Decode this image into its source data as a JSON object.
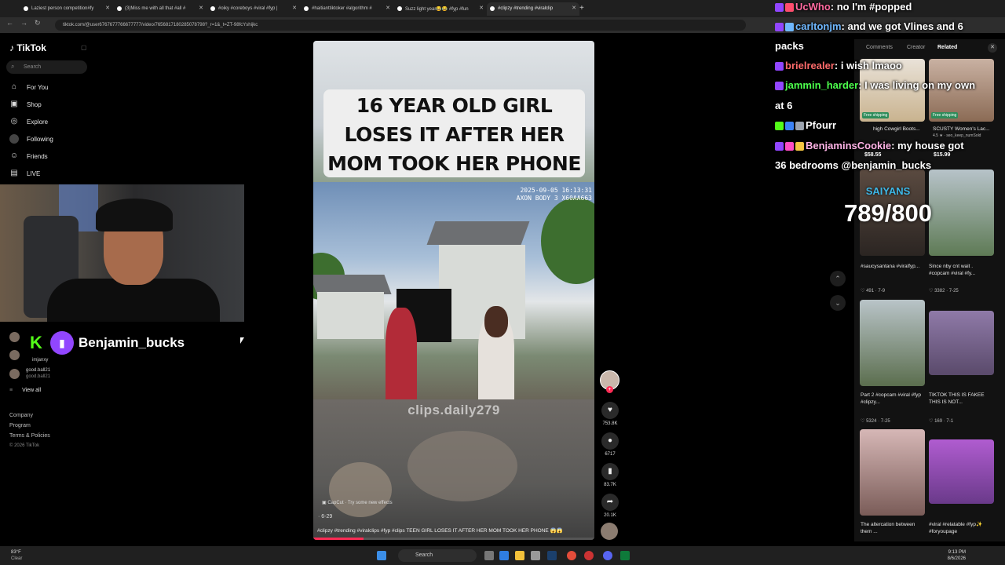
{
  "browser": {
    "tabs": [
      {
        "title": "Laziest person competition#fy"
      },
      {
        "title": "(3)Miss me with all that #all #"
      },
      {
        "title": "#oiky #coreboys #viral #fyp |"
      },
      {
        "title": "#haitianttiktoker #algorithm #"
      },
      {
        "title": "Suzz light year😂😂 #fyp #fun"
      },
      {
        "title": "#clipzy #trending #viralclip"
      }
    ],
    "url": "tiktok.com/@user6767677766677777/video/7656817180285078798?_r=1&_t=ZT-98fcYshijkc"
  },
  "sidebar": {
    "logo": "TikTok",
    "search_placeholder": "Search",
    "nav": [
      {
        "label": "For You",
        "icon": "home-icon"
      },
      {
        "label": "Shop",
        "icon": "shop-icon"
      },
      {
        "label": "Explore",
        "icon": "compass-icon"
      },
      {
        "label": "Following",
        "icon": "following-icon"
      },
      {
        "label": "Friends",
        "icon": "friends-icon"
      },
      {
        "label": "LIVE",
        "icon": "live-icon"
      }
    ],
    "following": [
      {
        "name": "imjanxy",
        "handle": "imjanxy"
      },
      {
        "name": "good.ball21",
        "handle": "good.ball21"
      }
    ],
    "view_all": "View all",
    "footer": [
      "Company",
      "Program",
      "Terms & Policies",
      "© 2026 TikTok"
    ]
  },
  "stream": {
    "twitch_name": "Benjamin_bucks"
  },
  "video": {
    "headline": "16 YEAR OLD GIRL LOSES IT AFTER HER MOM TOOK HER PHONE 😱🤦🏽‍♀️💔",
    "bodycam_time": "2025-09-05 16:13:31",
    "bodycam_id": "AXON BODY 3 X60AA663",
    "watermark": "clips.daily279",
    "capcut": "CapCut · Try some new effects",
    "date": "· 6-29",
    "caption": "#clipzy #trending #viralclips #fyp #clips TEEN GIRL LOSES IT AFTER HER MOM TOOK HER PHONE 😱😱",
    "progress": 0.18
  },
  "actions": {
    "likes": "753.8K",
    "comments": "6717",
    "saves": "83.7K",
    "shares": "20.1K"
  },
  "panel": {
    "tabs": [
      "Comments",
      "Creator",
      "Related"
    ],
    "active_tab": "Related",
    "items": [
      {
        "title": "Free shipping",
        "sub": "high Cowgirl Boots...",
        "price": "$58.55"
      },
      {
        "title": "SCUSTY Women's Lac...",
        "sub": "4.5 ★ · seo_keep_numSold",
        "price": "$15.99"
      },
      {
        "title": "#saucysantana #viralfyp...",
        "meta": "491 · 7-9"
      },
      {
        "title": "Since nby cnt wait . #copcam #viral #fy...",
        "meta": "3382 · 7-25"
      },
      {
        "title": "Part 2 #copcam #viral #fyp #clipzy...",
        "meta": "5324 · 7-25"
      },
      {
        "title": "TIKTOK THIS IS FAKEE THIS IS NOT...",
        "meta": "169 · 7-1"
      },
      {
        "title": "The altercation between them ...",
        "meta": ""
      },
      {
        "title": "#viral #relatable #fyp✨ #foryoupage",
        "meta": ""
      }
    ]
  },
  "chat": [
    {
      "user": "UcWho",
      "color": "#ff6aa0",
      "msg": "no I'm #popped"
    },
    {
      "user": "carltonjm",
      "color": "#6fb8ff",
      "msg": "and we got Vlines and 6"
    },
    {
      "user": "",
      "color": "#ffffff",
      "msg": "packs"
    },
    {
      "user": "brielrealer",
      "color": "#ff6b6b",
      "msg": "i wish lmaoo"
    },
    {
      "user": "jammin_harder",
      "color": "#4cff4c",
      "msg": "I was living on my own"
    },
    {
      "user": "",
      "color": "#ffffff",
      "msg": "at 6"
    },
    {
      "user": "Pfourr",
      "color": "#ffffff",
      "msg": ""
    },
    {
      "user": "BenjaminsCookie",
      "color": "#ffb3e6",
      "msg": "my house got"
    },
    {
      "user": "",
      "color": "#ffffff",
      "msg": "36 bedrooms @benjamin_bucks"
    }
  ],
  "goal": {
    "label": "SAIYANS",
    "count": "789/800"
  },
  "taskbar": {
    "weather_temp": "83°F",
    "weather_desc": "Clear",
    "search": "Search",
    "time": "9:13 PM",
    "date": "8/6/2026"
  }
}
